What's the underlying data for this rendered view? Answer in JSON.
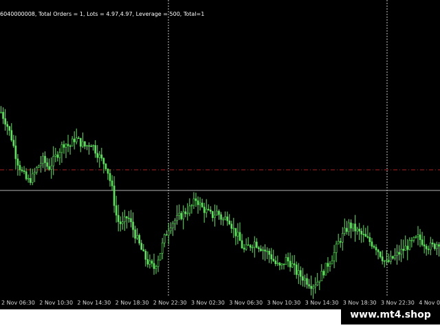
{
  "chart_info": {
    "text": "6040000008, Total Orders = 1, Lots = 4.97,4.97, Leverage = 500, Total=1"
  },
  "time_axis": {
    "labels": [
      "2 Nov 06:30",
      "2 Nov 10:30",
      "2 Nov 14:30",
      "2 Nov 18:30",
      "2 Nov 22:30",
      "3 Nov 02:30",
      "3 Nov 06:30",
      "3 Nov 10:30",
      "3 Nov 14:30",
      "3 Nov 18:30",
      "3 Nov 22:30",
      "4 Nov 0"
    ]
  },
  "watermark": {
    "text": "www.mt4.shop"
  },
  "colors": {
    "background": "#000000",
    "candle": "#5CE65C",
    "period_separator": "#c8c8c8",
    "order_line": "#b02020",
    "bid_line": "#b4b4b4",
    "text": "#ffffff"
  },
  "chart_data": {
    "type": "candlestick",
    "timeframe_note": "",
    "closes": [
      0.8,
      0.75,
      0.68,
      0.58,
      0.52,
      0.48,
      0.5,
      0.55,
      0.58,
      0.54,
      0.58,
      0.62,
      0.66,
      0.64,
      0.68,
      0.66,
      0.64,
      0.66,
      0.62,
      0.58,
      0.55,
      0.45,
      0.3,
      0.28,
      0.32,
      0.26,
      0.2,
      0.14,
      0.1,
      0.08,
      0.14,
      0.22,
      0.28,
      0.3,
      0.32,
      0.34,
      0.36,
      0.4,
      0.36,
      0.34,
      0.32,
      0.34,
      0.3,
      0.32,
      0.26,
      0.22,
      0.16,
      0.18,
      0.2,
      0.18,
      0.16,
      0.14,
      0.1,
      0.08,
      0.12,
      0.1,
      0.06,
      0.04,
      0.02,
      0.0,
      0.02,
      0.06,
      0.1,
      0.14,
      0.2,
      0.24,
      0.28,
      0.26,
      0.24,
      0.22,
      0.2,
      0.18,
      0.14,
      0.1,
      0.12,
      0.14,
      0.16,
      0.18,
      0.2,
      0.22,
      0.2,
      0.18,
      0.18,
      0.2
    ]
  }
}
